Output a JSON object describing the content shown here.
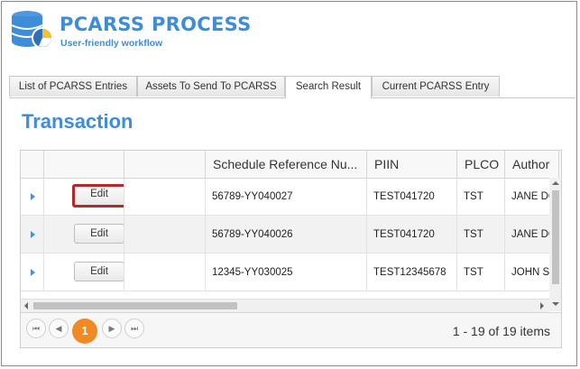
{
  "header": {
    "title": "PCARSS PROCESS",
    "subtitle": "User-friendly workflow"
  },
  "tabs": [
    {
      "label": "List of PCARSS Entries",
      "active": false
    },
    {
      "label": "Assets To Send To PCARSS",
      "active": false
    },
    {
      "label": "Search Result",
      "active": true
    },
    {
      "label": "Current PCARSS Entry",
      "active": false
    }
  ],
  "section": {
    "title": "Transaction"
  },
  "grid": {
    "columns": [
      "",
      "",
      "",
      "Schedule Reference Nu...",
      "PIIN",
      "PLCO",
      "Author"
    ],
    "edit_label": "Edit",
    "rows": [
      {
        "schedule_ref": "56789-YY040027",
        "piin": "TEST041720",
        "plco": "TST",
        "author": "JANE DO",
        "highlighted": true
      },
      {
        "schedule_ref": "56789-YY040026",
        "piin": "TEST041720",
        "plco": "TST",
        "author": "JANE DO",
        "highlighted": false
      },
      {
        "schedule_ref": "12345-YY030025",
        "piin": "TEST12345678",
        "plco": "TST",
        "author": "JOHN SM",
        "highlighted": false
      }
    ]
  },
  "pager": {
    "first": "⏮",
    "prev": "◀",
    "current_page": "1",
    "next": "▶",
    "last": "⏭",
    "info": "1 - 19 of 19 items"
  },
  "colors": {
    "brand": "#3f8dd8",
    "highlight_border": "#b42a2a",
    "current_page": "#f08a24"
  }
}
